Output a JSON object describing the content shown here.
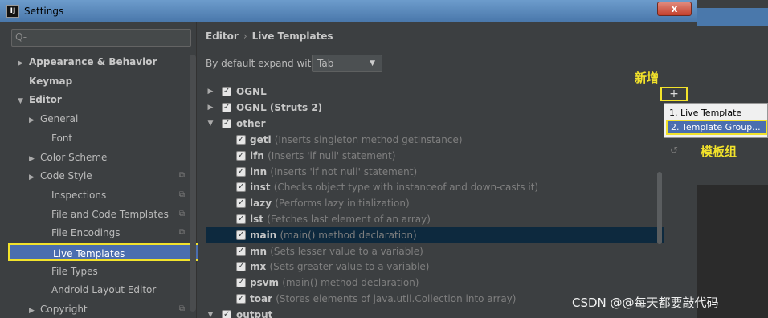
{
  "window": {
    "title": "Settings",
    "app_icon_label": "IJ",
    "close_label": "x"
  },
  "sidebar": {
    "search_placeholder": "Q-",
    "items": [
      {
        "label": "Appearance & Behavior",
        "arrow": "▶",
        "bold": true
      },
      {
        "label": "Keymap",
        "arrow": "",
        "bold": true
      },
      {
        "label": "Editor",
        "arrow": "▼",
        "bold": true
      },
      {
        "label": "General",
        "arrow": "▶"
      },
      {
        "label": "Font",
        "arrow": ""
      },
      {
        "label": "Color Scheme",
        "arrow": "▶"
      },
      {
        "label": "Code Style",
        "arrow": "▶",
        "copy": true
      },
      {
        "label": "Inspections",
        "arrow": "",
        "copy": true
      },
      {
        "label": "File and Code Templates",
        "arrow": "",
        "copy": true
      },
      {
        "label": "File Encodings",
        "arrow": "",
        "copy": true
      },
      {
        "label": "Live Templates",
        "arrow": "",
        "selected": true
      },
      {
        "label": "File Types",
        "arrow": ""
      },
      {
        "label": "Android Layout Editor",
        "arrow": ""
      },
      {
        "label": "Copyright",
        "arrow": "▶",
        "copy": true
      }
    ]
  },
  "main": {
    "breadcrumb": {
      "parent": "Editor",
      "separator": "›",
      "current": "Live Templates"
    },
    "expand_label": "By default expand with",
    "expand_value": "Tab",
    "groups": [
      {
        "arrow": "▶",
        "name": "OGNL"
      },
      {
        "arrow": "▶",
        "name": "OGNL (Struts 2)"
      },
      {
        "arrow": "▼",
        "name": "other"
      }
    ],
    "templates": [
      {
        "abbr": "geti",
        "desc": "(Inserts singleton method getInstance)"
      },
      {
        "abbr": "ifn",
        "desc": "(Inserts 'if null' statement)"
      },
      {
        "abbr": "inn",
        "desc": "(Inserts 'if not null' statement)"
      },
      {
        "abbr": "inst",
        "desc": "(Checks object type with instanceof and down-casts it)"
      },
      {
        "abbr": "lazy",
        "desc": "(Performs lazy initialization)"
      },
      {
        "abbr": "lst",
        "desc": "(Fetches last element of an array)"
      },
      {
        "abbr": "main",
        "desc": "(main() method declaration)",
        "highlight": true
      },
      {
        "abbr": "mn",
        "desc": "(Sets lesser value to a variable)"
      },
      {
        "abbr": "mx",
        "desc": "(Sets greater value to a variable)"
      },
      {
        "abbr": "psvm",
        "desc": "(main() method declaration)"
      },
      {
        "abbr": "toar",
        "desc": "(Stores elements of java.util.Collection into array)"
      }
    ],
    "last_group": {
      "arrow": "▼",
      "name": "output"
    }
  },
  "toolbar": {
    "add": "+",
    "undo": "↺"
  },
  "popup": {
    "items": [
      {
        "label": "1. Live Template"
      },
      {
        "label": "2. Template Group...",
        "active": true
      }
    ]
  },
  "annotations": {
    "add_note": "新增",
    "group_note": "模板组",
    "watermark": "CSDN @@每天都要敲代码"
  },
  "colors": {
    "selection": "#4b6eaf",
    "annotation": "#f2e22b",
    "highlight_row": "#0d293e"
  }
}
